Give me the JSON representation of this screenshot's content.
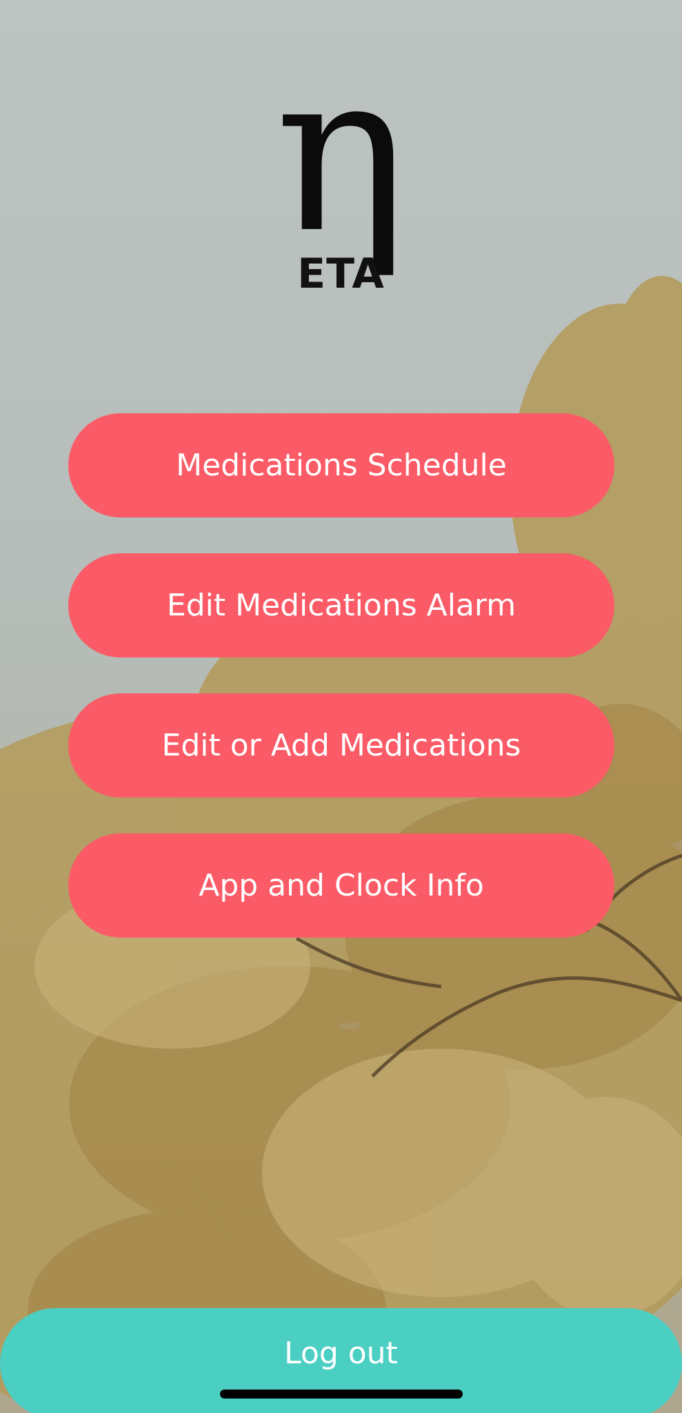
{
  "logo": {
    "glyph": "η",
    "text": "ETA"
  },
  "menu": {
    "items": [
      {
        "label": "Medications Schedule"
      },
      {
        "label": "Edit Medications Alarm"
      },
      {
        "label": "Edit or Add Medications"
      },
      {
        "label": "App and Clock Info"
      }
    ]
  },
  "logout": {
    "label": "Log out"
  },
  "colors": {
    "menu_button": "#fa5b66",
    "logout_button": "#4ccfc3",
    "logo": "#0b0b0b",
    "text_on_button": "#ffffff"
  },
  "background": {
    "description_icon": "tree-branches-photo"
  }
}
